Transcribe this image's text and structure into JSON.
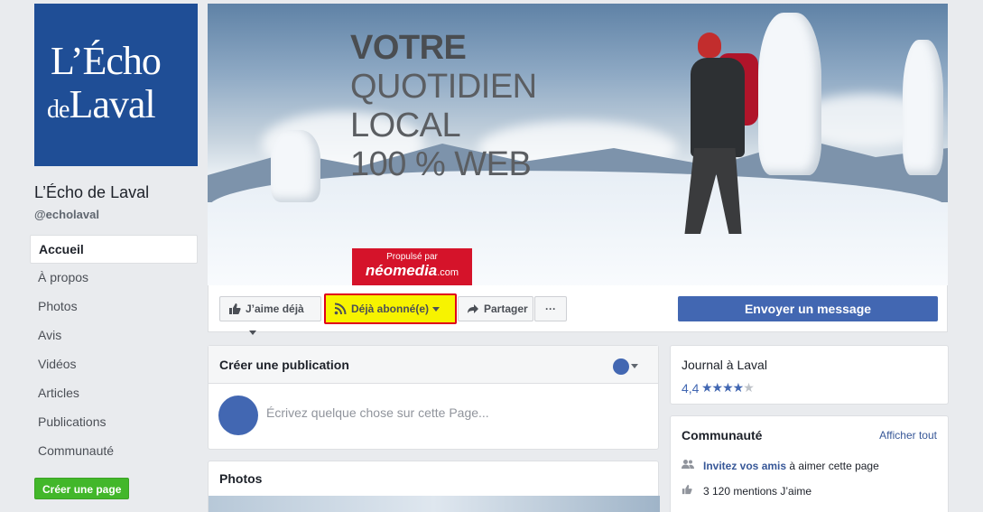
{
  "sidebar": {
    "logo_line1": "L’Écho",
    "logo_line2_small": "de",
    "logo_line2": "Laval",
    "page_name": "L’Écho de Laval",
    "handle": "@echolaval",
    "items": [
      {
        "label": "Accueil"
      },
      {
        "label": "À propos"
      },
      {
        "label": "Photos"
      },
      {
        "label": "Avis"
      },
      {
        "label": "Vidéos"
      },
      {
        "label": "Articles"
      },
      {
        "label": "Publications"
      },
      {
        "label": "Communauté"
      }
    ],
    "create_page": "Créer une page"
  },
  "cover": {
    "line1": "VOTRE",
    "line2": "QUOTIDIEN",
    "line3": "LOCAL",
    "line4": "100 % WEB",
    "badge_top": "Propulsé par",
    "badge_brand": "néomedia",
    "badge_suffix": ".com"
  },
  "actions": {
    "like": "J’aime déjà",
    "follow": "Déjà abonné(e)",
    "share": "Partager",
    "more": "···",
    "message": "Envoyer un message"
  },
  "create_post": {
    "title": "Créer une publication",
    "placeholder": "Écrivez quelque chose sur cette Page..."
  },
  "photos": {
    "title": "Photos"
  },
  "about": {
    "category": "Journal à Laval",
    "rating": "4,4",
    "rating_value": 4.4,
    "rating_max": 5
  },
  "community": {
    "title": "Communauté",
    "see_all": "Afficher tout",
    "invite_link": "Invitez vos amis",
    "invite_rest": " à aimer cette page",
    "likes": "3 120 mentions J’aime"
  },
  "colors": {
    "fb_blue": "#4267b2",
    "follow_highlight": "#f7f300",
    "highlight_border": "#e0001a",
    "green": "#42b72a"
  }
}
